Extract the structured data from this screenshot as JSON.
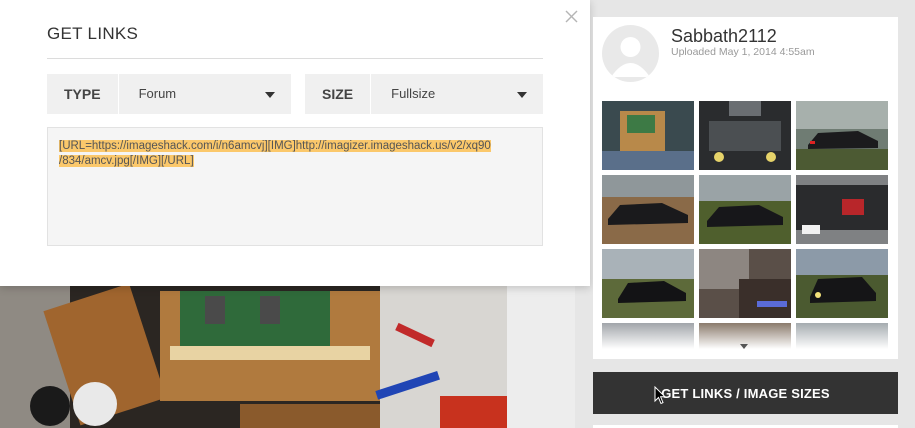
{
  "modal": {
    "title": "GET LINKS",
    "type_label": "TYPE",
    "type_value": "Forum",
    "size_label": "SIZE",
    "size_value": "Fullsize",
    "code_line1": "[URL=https://imageshack.com/i/n6amcvj][IMG]http://imagizer.imageshack.us/v2/xq90",
    "code_line2": "/834/amcv.jpg[/IMG][/URL]",
    "icons": {
      "close": "close-icon",
      "type_dropdown": "chevron-down-icon",
      "size_dropdown": "chevron-down-icon"
    }
  },
  "user": {
    "name": "Sabbath2112",
    "uploaded": "Uploaded May 1, 2014 4:55am",
    "avatar_icon": "user-avatar-icon"
  },
  "thumbnails": [
    "project-board-photo",
    "mustang-engine-bay-photo",
    "mustang-side-dusk-photo",
    "mustang-side-lawn-photo",
    "mustang-side-grass-photo",
    "mustang-rear-photo",
    "mustang-side-trees-photo",
    "mustang-interior-photo",
    "mustang-front-night-photo",
    "thumbnail-partial-photo",
    "thumbnail-partial-photo",
    "thumbnail-partial-photo"
  ],
  "actions": {
    "get_links_label": "GET LINKS / IMAGE SIZES"
  },
  "colors": {
    "button_bg": "#333333",
    "code_highlight": "#fbc86b",
    "panel_bg": "#e6e6e6"
  }
}
